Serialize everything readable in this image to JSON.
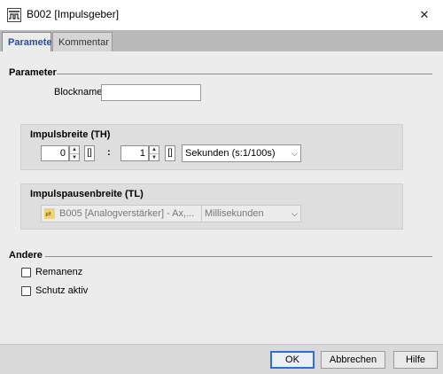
{
  "window": {
    "title": "B002 [Impulsgeber]",
    "close_glyph": "✕"
  },
  "tabs": [
    {
      "label": "Parameter",
      "active": true
    },
    {
      "label": "Kommentar",
      "active": false
    }
  ],
  "parameter": {
    "section_title": "Parameter",
    "blockname_label": "Blockname:",
    "blockname_value": ""
  },
  "impulse_width": {
    "title": "Impulsbreite (TH)",
    "value1": "0",
    "bracket1": "[]",
    "separator": ":",
    "value2": "1",
    "bracket2": "[]",
    "unit": "Sekunden (s:1/100s)"
  },
  "impulse_pause": {
    "title": "Impulspausenbreite (TL)",
    "source": "B005 [Analogverstärker] - Ax,...",
    "unit": "Millisekunden"
  },
  "other": {
    "section_title": "Andere",
    "checkboxes": [
      {
        "label": "Remanenz",
        "checked": false
      },
      {
        "label": "Schutz aktiv",
        "checked": false
      }
    ]
  },
  "buttons": {
    "ok": "OK",
    "cancel": "Abbrechen",
    "help": "Hilfe"
  },
  "icons": {
    "spin_up": "▲",
    "spin_down": "▼",
    "dropdown": "⌵"
  },
  "colors": {
    "active_tab": "#2a4da0",
    "default_button_border": "#2f6fd0"
  }
}
